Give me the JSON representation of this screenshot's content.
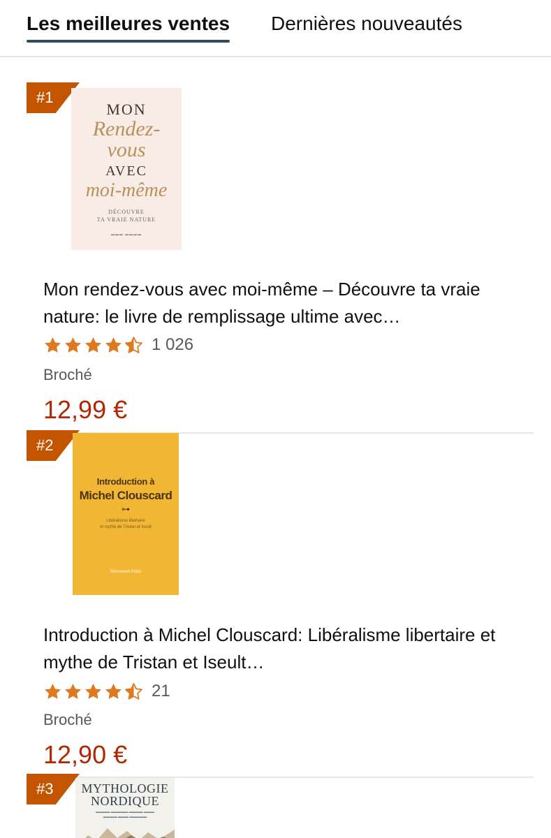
{
  "tabs": [
    {
      "label": "Les meilleures ventes",
      "active": true
    },
    {
      "label": "Dernières nouveautés",
      "active": false
    }
  ],
  "colors": {
    "rank_badge": "#c45500",
    "star": "#de7921",
    "price": "#b12704",
    "tab_underline": "#2e4d62"
  },
  "products": [
    {
      "rank": "#1",
      "cover": {
        "line1": "MON",
        "line2": "Rendez-",
        "line3": "vous",
        "line4": "AVEC",
        "line5": "moi-même",
        "subtitle_1": "DÉCOUVRE",
        "subtitle_2": "TA VRAIE NATURE"
      },
      "title": "Mon rendez-vous avec moi-même – Découvre ta vraie nature: le livre de remplissage ultime avec…",
      "rating_stars": 4.5,
      "rating_count": "1 026",
      "format": "Broché",
      "price": "12,99 €"
    },
    {
      "rank": "#2",
      "cover": {
        "line1": "Introduction à",
        "line2": "Michel Clouscard",
        "subtitle_1": "Libéralisme libertaire",
        "subtitle_2": "et mythe de Tristan et Iseult",
        "author": "Mohamed Pidai"
      },
      "title": "Introduction à Michel Clouscard: Libéralisme libertaire et mythe de Tristan et Iseult…",
      "rating_stars": 4.5,
      "rating_count": "21",
      "format": "Broché",
      "price": "12,90 €"
    },
    {
      "rank": "#3",
      "cover": {
        "line1": "MYTHOLOGIE",
        "line2": "NORDIQUE"
      }
    }
  ]
}
